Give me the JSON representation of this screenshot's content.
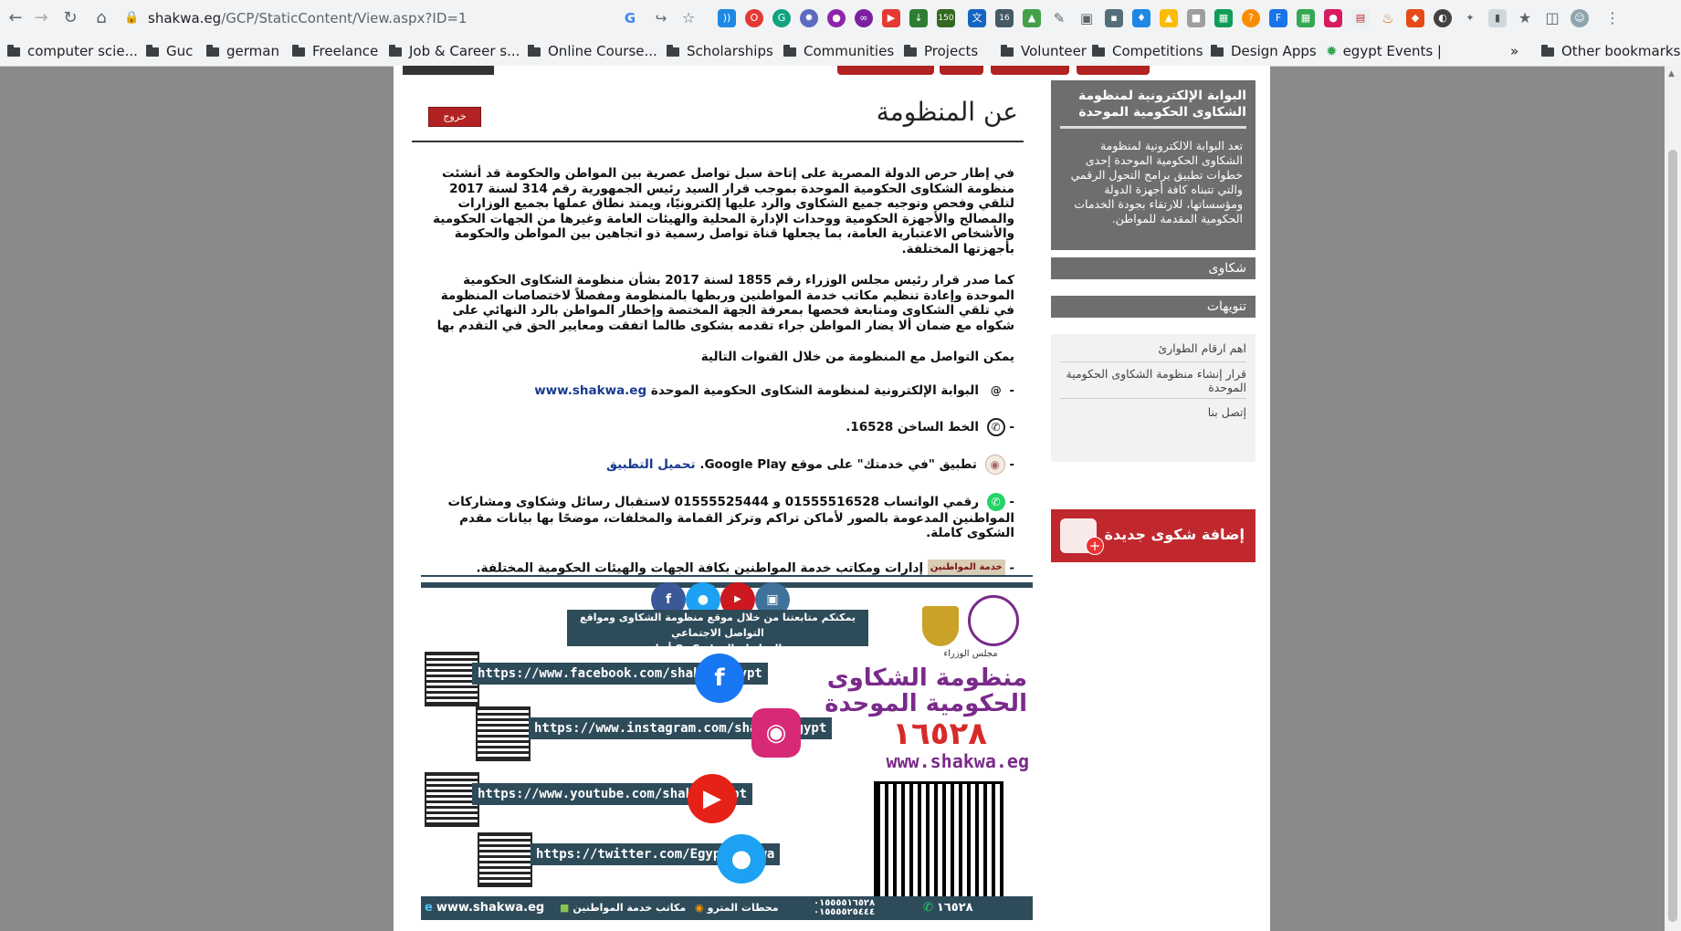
{
  "browser": {
    "url_domain": "shakwa.eg",
    "url_path": "/GCP/StaticContent/View.aspx?ID=1",
    "bookmarks": [
      "computer scie...",
      "Guc",
      "german",
      "Freelance",
      "Job & Career s...",
      "Online Course...",
      "Scholarships",
      "Communities",
      "Projects",
      "Volunteer",
      "Competitions",
      "Design Apps",
      "egypt Events |"
    ],
    "more": "»",
    "other_bookmarks": "Other bookmarks",
    "ext_badges": [
      "150",
      "16"
    ]
  },
  "page": {
    "title": "عن المنظومة",
    "logout": "خروج",
    "para1": "في إطار حرص الدولة المصرية على إتاحة سبل تواصل عصرية بين المواطن والحكومة قد أنشئت منظومة الشكاوى الحكومية الموحدة بموجب قرار السيد رئيس الجمهورية رقم 314 لسنة 2017 لتلقي وفحص وتوجيه جميع الشكاوى والرد عليها إلكترونيًا، ويمتد نطاق عملها بجميع الوزارات والمصالح والأجهزة الحكومية ووحدات الإدارة المحلية والهيئات العامة وغيرها من الجهات الحكومية والأشخاص الاعتبارية العامة، بما يجعلها قناة تواصل رسمية ذو اتجاهين بين المواطن والحكومة بأجهزتها المختلفة.",
    "para2": "كما صدر قرار رئيس مجلس الوزراء رقم 1855 لسنة 2017 بشأن منظومة الشكاوى الحكومية الموحدة وإعادة تنظيم مكاتب خدمة المواطنين وربطها بالمنظومة ومفصلاً لاختصاصات المنظومة في تلقي الشكاوى ومتابعة فحصها بمعرفة الجهة المختصة وإخطار المواطن بالرد النهائي على شكواه مع ضمان ألا يضار المواطن جراء تقدمه بشكوى طالما اتفقت ومعايير الحق في التقدم بها",
    "channels_intro": "يمكن التواصل مع المنظومة من خلال القنوات التالية",
    "ch1_text": "البوابة الإلكترونية لمنظومة الشكاوى الحكومية الموحدة",
    "ch1_link": "www.shakwa.eg",
    "ch2_text": "الخط الساخن 16528.",
    "ch3_text": "تطبيق \"في خدمتك\" على موقع Google Play.",
    "ch3_link": "تحميل التطبيق",
    "ch4_text": "رقمي الواتساب 01555516528 و 01555525444 لاستقبال رسائل وشكاوى ومشاركات المواطنين المدعومة بالصور لأماكن تراكم وتركز القمامة والمخلفات، موضحًا بها بيانات مقدم الشكوى كاملة.",
    "ch5_badge": "خدمة المواطنين",
    "ch5_text": "إدارات ومكاتب خدمة المواطنين بكافة الجهات والهيئات الحكومية المختلفة.",
    "dash": "-"
  },
  "infographic": {
    "caption_line1": "يمكنكم متابعتنا من خلال موقع منظومة الشكاوى ومواقع التواصل الاجتماعي",
    "caption_line2": "بالروابط والـ Qr Code أدناه",
    "ministry": "مجلس الوزراء",
    "brand_line1": "منظومة الشكاوى",
    "brand_line2": "الحكومية الموحدة",
    "brand_number": "١٦٥٢٨",
    "brand_url": "www.shakwa.eg",
    "facebook_url": "https://www.facebook.com/shakwa.egypt",
    "instagram_url": "https://www.instagram.com/shakwa.egypt",
    "youtube_url": "https://www.youtube.com/shakwaegypt",
    "twitter_url": "https://twitter.com/EgyptShakwa",
    "footer_site": "www.shakwa.eg",
    "footer_offices": "مكاتب خدمة المواطنين",
    "footer_metro": "محطات المترو",
    "footer_wa1": "٠١٥٥٥٥١٦٥٢٨",
    "footer_wa2": "٠١٥٥٥٥٢٥٤٤٤",
    "footer_hotline": "١٦٥٢٨"
  },
  "sidebar": {
    "title": "البوابة الإلكترونية لمنظومة الشكاوى الحكومية الموحدة",
    "desc": "تعد البوابة الالكترونية لمنظومة الشكاوى الحكومية الموحدة إحدى خطوات تطبيق برامج التحول الرقمي والتي تتبناه كافة أجهزة الدولة ومؤسساتها، للارتقاء بجودة الخدمات الحكومية المقدمة للمواطن.",
    "complaints": "شكاوى",
    "notices": "تنويهات",
    "link1": "اهم ارقام الطوارئ",
    "link2": "قرار إنشاء منظومة الشكاوى الحكومية الموحدة",
    "link3": "إتصل بنا",
    "new_complaint": "إضافة شكوى جديدة",
    "plus": "+"
  },
  "colors": {
    "accent_red": "#b22222",
    "sidebar_gray": "#6e6e6e",
    "infographic_blue": "#2e4b5a"
  }
}
